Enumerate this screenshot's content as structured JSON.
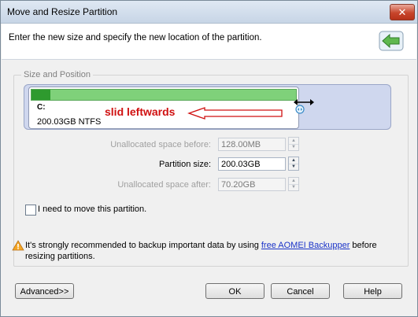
{
  "window": {
    "title": "Move and Resize Partition",
    "close_glyph": "✕"
  },
  "header": {
    "instruction": "Enter the new size and specify the new location of the partition.",
    "icon": "back-arrow-icon"
  },
  "group": {
    "legend": "Size and Position"
  },
  "partition": {
    "letter": "C:",
    "info": "200.03GB NTFS",
    "used_fraction": 0.07
  },
  "annotation": {
    "text": "slid leftwards",
    "color": "#d01010"
  },
  "fields": {
    "before": {
      "label": "Unallocated space before:",
      "value": "128.00MB"
    },
    "size": {
      "label": "Partition size:",
      "value": "200.03GB"
    },
    "after": {
      "label": "Unallocated space after:",
      "value": "70.20GB"
    }
  },
  "move_checkbox": {
    "label": "I need to move this partition.",
    "checked": false
  },
  "warning": {
    "prefix": "It's strongly recommended to backup important data by using ",
    "link": "free AOMEI Backupper",
    "suffix": " before resizing partitions."
  },
  "buttons": {
    "advanced": "Advanced>>",
    "ok": "OK",
    "cancel": "Cancel",
    "help": "Help"
  },
  "colors": {
    "accent": "#2e9a2e",
    "free_space": "#7fd17a",
    "disk_bg": "#cfd7ee"
  }
}
